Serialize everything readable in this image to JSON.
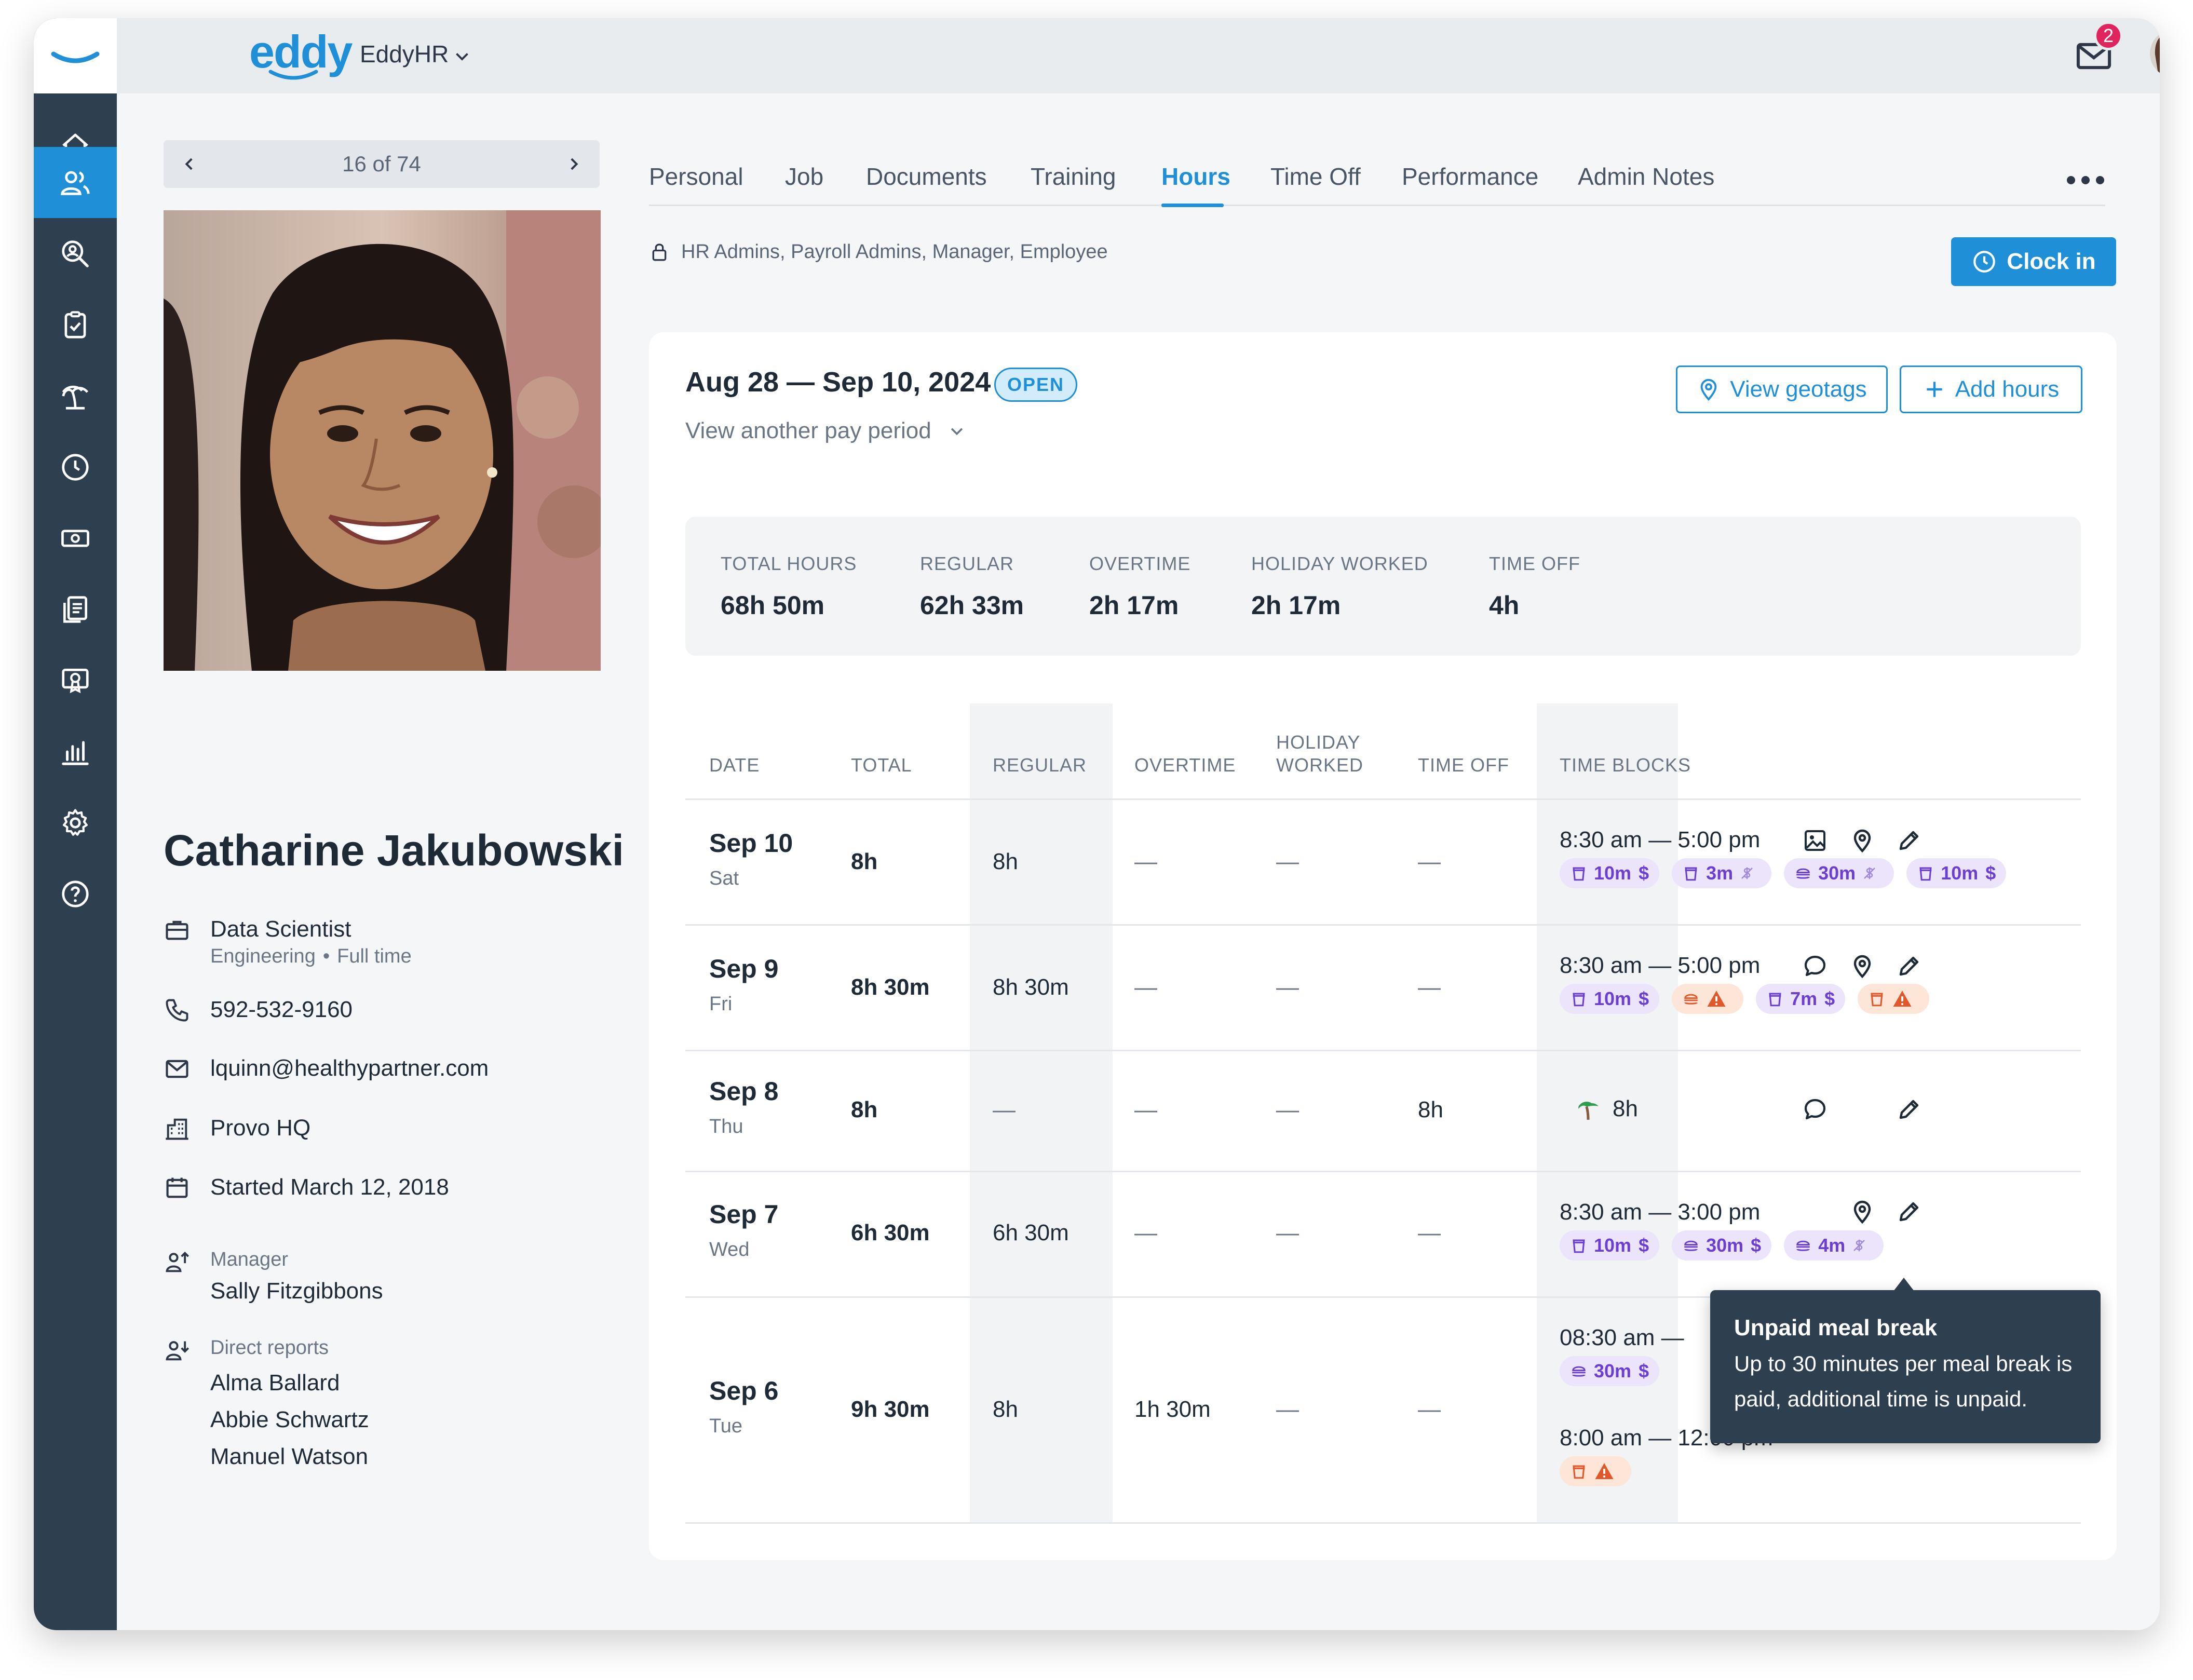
{
  "header": {
    "brand": "eddy",
    "org_name": "EddyHR",
    "mail_count": "2"
  },
  "pager": {
    "label": "16 of 74"
  },
  "employee": {
    "name": "Catharine Jakubowski",
    "title": "Data Scientist",
    "department": "Engineering",
    "employment": "Full time",
    "phone": "592-532-9160",
    "email": "lquinn@healthypartner.com",
    "location": "Provo HQ",
    "started": "Started March 12, 2018",
    "manager_label": "Manager",
    "manager": "Sally Fitzgibbons",
    "reports_label": "Direct reports",
    "reports": [
      "Alma Ballard",
      "Abbie Schwartz",
      "Manuel Watson"
    ]
  },
  "tabs": [
    "Personal",
    "Job",
    "Documents",
    "Training",
    "Hours",
    "Time Off",
    "Performance",
    "Admin Notes"
  ],
  "active_tab": "Hours",
  "access": "HR Admins, Payroll Admins,  Manager, Employee",
  "clock_in": "Clock in",
  "period": {
    "range": "Aug 28 — Sep 10, 2024",
    "status": "OPEN",
    "another": "View another pay period",
    "view_geotags": "View geotags",
    "add_hours": "Add hours"
  },
  "summary": [
    {
      "label": "TOTAL HOURS",
      "value": "68h 50m"
    },
    {
      "label": "REGULAR",
      "value": "62h 33m"
    },
    {
      "label": "OVERTIME",
      "value": "2h 17m"
    },
    {
      "label": "HOLIDAY  WORKED",
      "value": "2h 17m"
    },
    {
      "label": "TIME OFF",
      "value": "4h"
    }
  ],
  "table": {
    "headers": {
      "date": "DATE",
      "total": "TOTAL",
      "regular": "REGULAR",
      "overtime": "OVERTIME",
      "holiday_1": "HOLIDAY",
      "holiday_2": "WORKED",
      "time_off": "TIME OFF",
      "time_blocks": "TIME BLOCKS"
    },
    "rows": [
      {
        "date": "Sep 10",
        "day": "Sat",
        "total": "8h",
        "regular": "8h",
        "overtime": "—",
        "holiday": "—",
        "time_off": "—",
        "blocks": [
          {
            "range": "8:30 am  —  5:00 pm"
          }
        ],
        "chips": [
          "10m",
          "$",
          "3m",
          "30m",
          "10m",
          "$"
        ]
      },
      {
        "date": "Sep 9",
        "day": "Fri",
        "total": "8h 30m",
        "regular": "8h 30m",
        "overtime": "—",
        "holiday": "—",
        "time_off": "—",
        "blocks": [
          {
            "range": "8:30 am  —  5:00 pm"
          }
        ],
        "chips": [
          "10m",
          "$",
          "7m",
          "$"
        ]
      },
      {
        "date": "Sep 8",
        "day": "Thu",
        "total": "8h",
        "regular": "—",
        "overtime": "—",
        "holiday": "—",
        "time_off": "8h",
        "blocks": [
          {
            "range": "8h"
          }
        ]
      },
      {
        "date": "Sep 7",
        "day": "Wed",
        "total": "6h 30m",
        "regular": "6h 30m",
        "overtime": "—",
        "holiday": "—",
        "time_off": "—",
        "blocks": [
          {
            "range": "8:30 am  —  3:00 pm"
          }
        ],
        "chips": [
          "10m",
          "$",
          "30m",
          "$",
          "4m"
        ]
      },
      {
        "date": "Sep 6",
        "day": "Tue",
        "total": "9h 30m",
        "regular": "8h",
        "overtime": "1h 30m",
        "holiday": "—",
        "time_off": "—",
        "blocks": [
          {
            "range": "08:30 am  —"
          },
          {
            "range": "8:00 am  —  12:00 pm"
          }
        ],
        "chips": [
          "30m",
          "$"
        ]
      }
    ]
  },
  "tooltip": {
    "title": "Unpaid meal break",
    "body": "Up to 30 minutes per meal break is paid, additional time is unpaid."
  },
  "colors": {
    "accent": "#1f8fd7",
    "sidebar": "#2e3f50",
    "chip_purple": "#6b3fd1",
    "chip_orange": "#e2582a"
  }
}
